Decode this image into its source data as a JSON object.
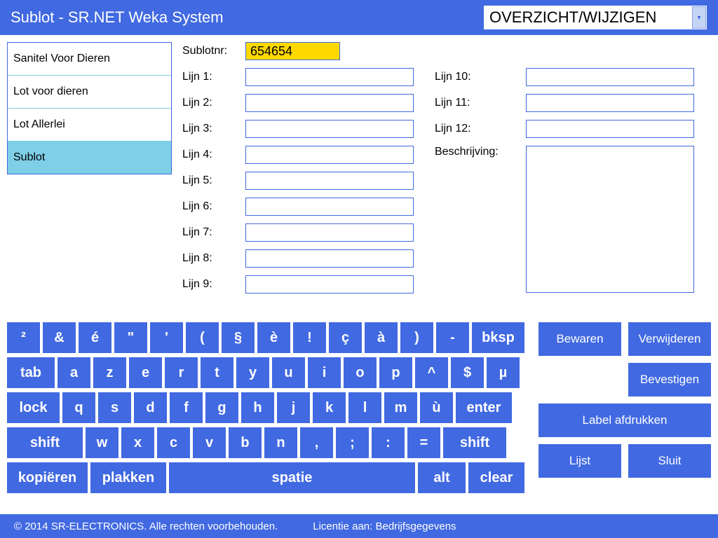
{
  "header": {
    "title": "Sublot - SR.NET Weka System",
    "mode": "OVERZICHT/WIJZIGEN"
  },
  "sidebar": {
    "items": [
      {
        "label": "Sanitel Voor Dieren",
        "active": false
      },
      {
        "label": "Lot voor dieren",
        "active": false
      },
      {
        "label": "Lot Allerlei",
        "active": false
      },
      {
        "label": "Sublot",
        "active": true
      }
    ]
  },
  "form": {
    "sublot_label": "Sublotnr:",
    "sublot_value": "654654",
    "lines_col1": [
      {
        "label": "Lijn 1:",
        "value": ""
      },
      {
        "label": "Lijn 2:",
        "value": ""
      },
      {
        "label": "Lijn 3:",
        "value": ""
      },
      {
        "label": "Lijn 4:",
        "value": ""
      },
      {
        "label": "Lijn 5:",
        "value": ""
      },
      {
        "label": "Lijn 6:",
        "value": ""
      },
      {
        "label": "Lijn 7:",
        "value": ""
      },
      {
        "label": "Lijn 8:",
        "value": ""
      },
      {
        "label": "Lijn 9:",
        "value": ""
      }
    ],
    "lines_col2": [
      {
        "label": "Lijn 10:",
        "value": ""
      },
      {
        "label": "Lijn 11:",
        "value": ""
      },
      {
        "label": "Lijn 12:",
        "value": ""
      }
    ],
    "desc_label": "Beschrijving:",
    "desc_value": ""
  },
  "keyboard": {
    "row1": [
      "²",
      "&",
      "é",
      "\"",
      "'",
      "(",
      "§",
      "è",
      "!",
      "ç",
      "à",
      ")",
      "-",
      "bksp"
    ],
    "row2": [
      "tab",
      "a",
      "z",
      "e",
      "r",
      "t",
      "y",
      "u",
      "i",
      "o",
      "p",
      "^",
      "$",
      "µ"
    ],
    "row3": [
      "lock",
      "q",
      "s",
      "d",
      "f",
      "g",
      "h",
      "j",
      "k",
      "l",
      "m",
      "ù",
      "enter"
    ],
    "row4": [
      "shift",
      "w",
      "x",
      "c",
      "v",
      "b",
      "n",
      ",",
      ";",
      ":",
      "=",
      "shift"
    ],
    "row5": [
      "kopiëren",
      "plakken",
      "spatie",
      "alt",
      "clear"
    ]
  },
  "actions": {
    "save": "Bewaren",
    "delete": "Verwijderen",
    "confirm": "Bevestigen",
    "print": "Label afdrukken",
    "list": "Lijst",
    "close": "Sluit"
  },
  "footer": {
    "copyright": "© 2014 SR-ELECTRONICS. Alle rechten voorbehouden.",
    "license": "Licentie aan: Bedrijfsgegevens"
  }
}
